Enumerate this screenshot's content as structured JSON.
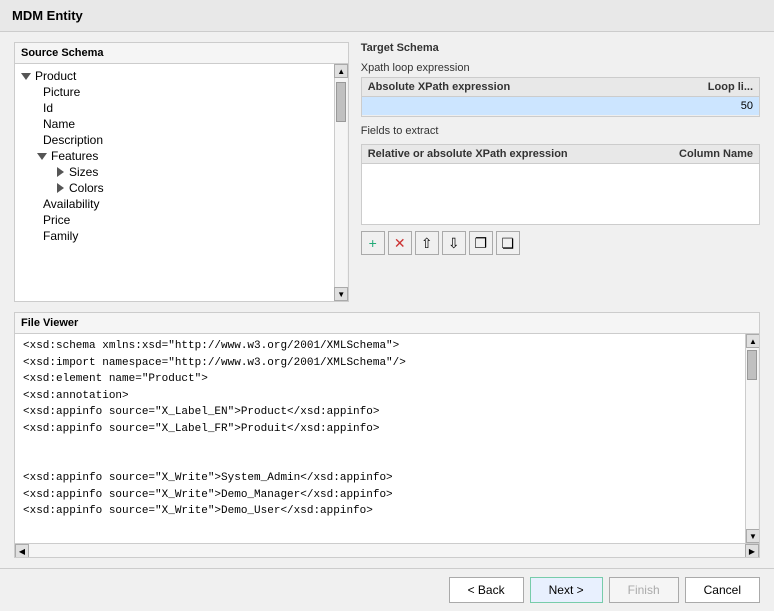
{
  "title": "MDM Entity",
  "source_schema": {
    "label": "Source Schema",
    "tree": {
      "root": "Product",
      "children": [
        {
          "label": "Picture",
          "indent": 1
        },
        {
          "label": "Id",
          "indent": 1
        },
        {
          "label": "Name",
          "indent": 1
        },
        {
          "label": "Description",
          "indent": 1
        },
        {
          "label": "Features",
          "indent": 1,
          "expanded": true,
          "children": [
            {
              "label": "Sizes",
              "indent": 2
            },
            {
              "label": "Colors",
              "indent": 2
            }
          ]
        },
        {
          "label": "Availability",
          "indent": 1
        },
        {
          "label": "Price",
          "indent": 1
        },
        {
          "label": "Family",
          "indent": 1
        }
      ]
    }
  },
  "target_schema": {
    "label": "Target Schema",
    "xpath_section": {
      "label": "Xpath loop expression",
      "columns": [
        {
          "label": "Absolute XPath expression"
        },
        {
          "label": "Loop li..."
        }
      ],
      "row": {
        "xpath": "",
        "loop": "50"
      }
    },
    "fields_section": {
      "label": "Fields to extract",
      "columns": [
        {
          "label": "Relative or absolute XPath expression"
        },
        {
          "label": "Column Name"
        }
      ],
      "toolbar": {
        "add": "+",
        "delete": "✕",
        "up": "↑",
        "down": "↓",
        "copy": "⧉",
        "paste": "⧈"
      }
    }
  },
  "file_viewer": {
    "label": "File Viewer",
    "content_lines": [
      "<xsd:schema xmlns:xsd=\"http://www.w3.org/2001/XMLSchema\">",
      "  <xsd:import namespace=\"http://www.w3.org/2001/XMLSchema\"/>",
      "  <xsd:element name=\"Product\">",
      "    <xsd:annotation>",
      "      <xsd:appinfo source=\"X_Label_EN\">Product</xsd:appinfo>",
      "      <xsd:appinfo source=\"X_Label_FR\">Produit</xsd:appinfo>",
      "",
      "",
      "      <xsd:appinfo source=\"X_Write\">System_Admin</xsd:appinfo>",
      "      <xsd:appinfo source=\"X_Write\">Demo_Manager</xsd:appinfo>",
      "      <xsd:appinfo source=\"X_Write\">Demo_User</xsd:appinfo>"
    ]
  },
  "buttons": {
    "back": "< Back",
    "next": "Next >",
    "finish": "Finish",
    "cancel": "Cancel"
  }
}
